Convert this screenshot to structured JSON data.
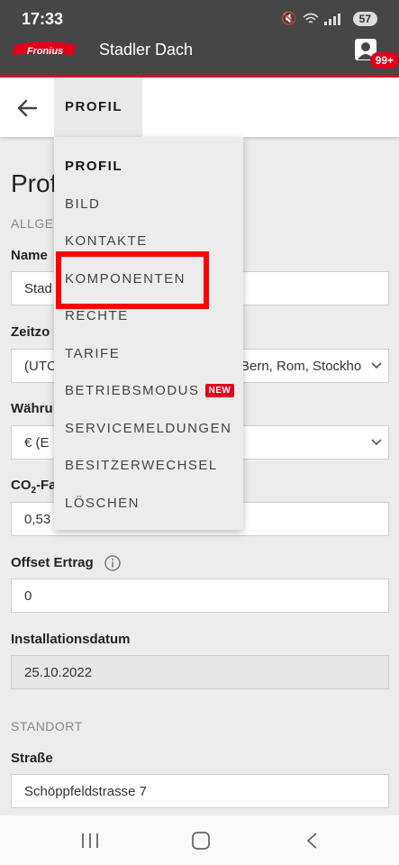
{
  "status_bar": {
    "time": "17:33",
    "battery": "57"
  },
  "app_bar": {
    "brand": "Fronius",
    "title": "Stadler Dach",
    "notification_count": "99+"
  },
  "tab_bar": {
    "active_tab": "PROFIL"
  },
  "menu": {
    "items": [
      {
        "label": "PROFIL"
      },
      {
        "label": "BILD"
      },
      {
        "label": "KONTAKTE"
      },
      {
        "label": "KOMPONENTEN"
      },
      {
        "label": "RECHTE"
      },
      {
        "label": "TARIFE"
      },
      {
        "label": "BETRIEBSMODUS",
        "badge": "NEW"
      },
      {
        "label": "SERVICEMELDUNGEN"
      },
      {
        "label": "BESITZERWECHSEL"
      },
      {
        "label": "LÖSCHEN"
      }
    ],
    "highlighted": "KOMPONENTEN"
  },
  "page": {
    "heading_visible": "Prof",
    "section_general": "ALLGE",
    "name_label": "Name",
    "name_value": "Stad",
    "timezone_label": "Zeitzo",
    "timezone_value_left": "(UTC",
    "timezone_value_right": "Bern, Rom, Stockho",
    "currency_label": "Währu",
    "currency_value": "€ (E",
    "co2_label_prefix": "CO",
    "co2_label_sub": "2",
    "co2_label_suffix": "-Fa",
    "co2_value": "0,53",
    "offset_label": "Offset Ertrag",
    "offset_value": "0",
    "install_label": "Installationsdatum",
    "install_value": "25.10.2022",
    "section_location": "STANDORT",
    "street_label": "Straße",
    "street_value": "Schöppfeldstrasse 7"
  },
  "colors": {
    "brand_red": "#e2001a",
    "appbar": "#464646",
    "highlight": "#ff0000"
  }
}
